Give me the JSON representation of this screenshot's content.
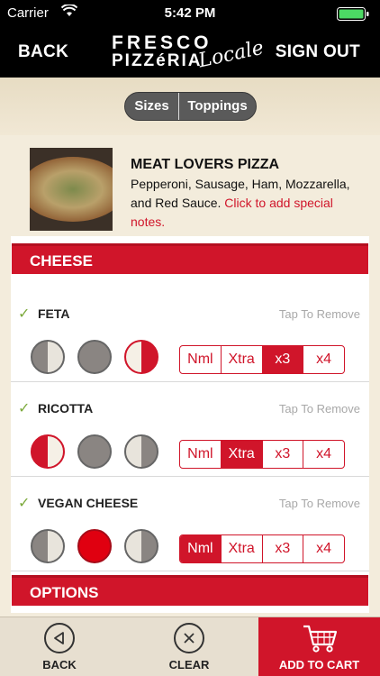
{
  "status_bar": {
    "carrier": "Carrier",
    "time": "5:42 PM"
  },
  "navbar": {
    "back_label": "BACK",
    "signout_label": "SIGN OUT",
    "logo": {
      "line1": "FRESCO",
      "line2": "PIZZéRIA",
      "line3": "Locale"
    }
  },
  "segmented": {
    "sizes": "Sizes",
    "toppings": "Toppings",
    "selected": "Toppings"
  },
  "product": {
    "title": "MEAT LOVERS PIZZA",
    "description": "Pepperoni, Sausage, Ham, Mozzarella, and Red Sauce.",
    "note_link": "Click to add special notes."
  },
  "sections": {
    "cheese": "CHEESE",
    "options": "OPTIONS"
  },
  "cheese_items": [
    {
      "name": "FETA",
      "remove": "Tap To Remove",
      "checked": true,
      "portion": "right-half",
      "amount": "x3",
      "amounts": [
        "Nml",
        "Xtra",
        "x3",
        "x4"
      ]
    },
    {
      "name": "RICOTTA",
      "remove": "Tap To Remove",
      "checked": true,
      "portion": "left-half",
      "amount": "Xtra",
      "amounts": [
        "Nml",
        "Xtra",
        "x3",
        "x4"
      ]
    },
    {
      "name": "VEGAN CHEESE",
      "remove": "Tap To Remove",
      "checked": true,
      "portion": "whole",
      "amount": "Nml",
      "amounts": [
        "Nml",
        "Xtra",
        "x3",
        "x4"
      ]
    }
  ],
  "toolbar": {
    "back": "BACK",
    "clear": "CLEAR",
    "add_to_cart": "ADD TO CART"
  },
  "colors": {
    "accent": "#d0152a",
    "background": "#f3ecdc",
    "check": "#7caa3c"
  }
}
